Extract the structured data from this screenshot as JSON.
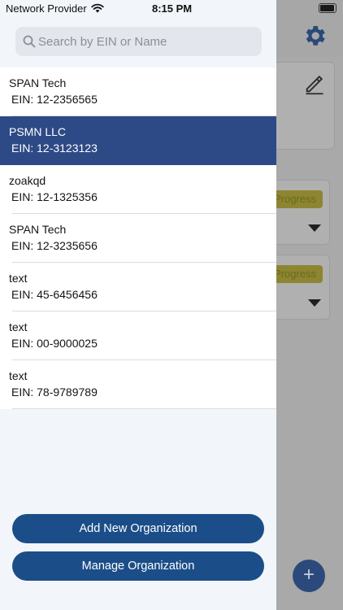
{
  "status_bar": {
    "carrier": "Network Provider",
    "time": "8:15 PM"
  },
  "search": {
    "placeholder": "Search by EIN or Name",
    "value": ""
  },
  "organizations": [
    {
      "name": "SPAN Tech",
      "ein": "EIN: 12-2356565",
      "selected": false
    },
    {
      "name": "PSMN LLC",
      "ein": "EIN: 12-3123123",
      "selected": true
    },
    {
      "name": "zoakqd",
      "ein": "EIN: 12-1325356",
      "selected": false
    },
    {
      "name": "SPAN Tech",
      "ein": "EIN: 12-3235656",
      "selected": false
    },
    {
      "name": "text",
      "ein": "EIN: 45-6456456",
      "selected": false
    },
    {
      "name": "text",
      "ein": "EIN: 00-9000025",
      "selected": false
    },
    {
      "name": "text",
      "ein": "EIN: 78-9789789",
      "selected": false
    }
  ],
  "buttons": {
    "add_label": "Add New Organization",
    "manage_label": "Manage Organization"
  },
  "background": {
    "badge_1": "InProgress",
    "badge_2": "InProgress",
    "fab_label": "+"
  },
  "colors": {
    "accent": "#1b4e88",
    "selected_row": "#2e4a86"
  }
}
